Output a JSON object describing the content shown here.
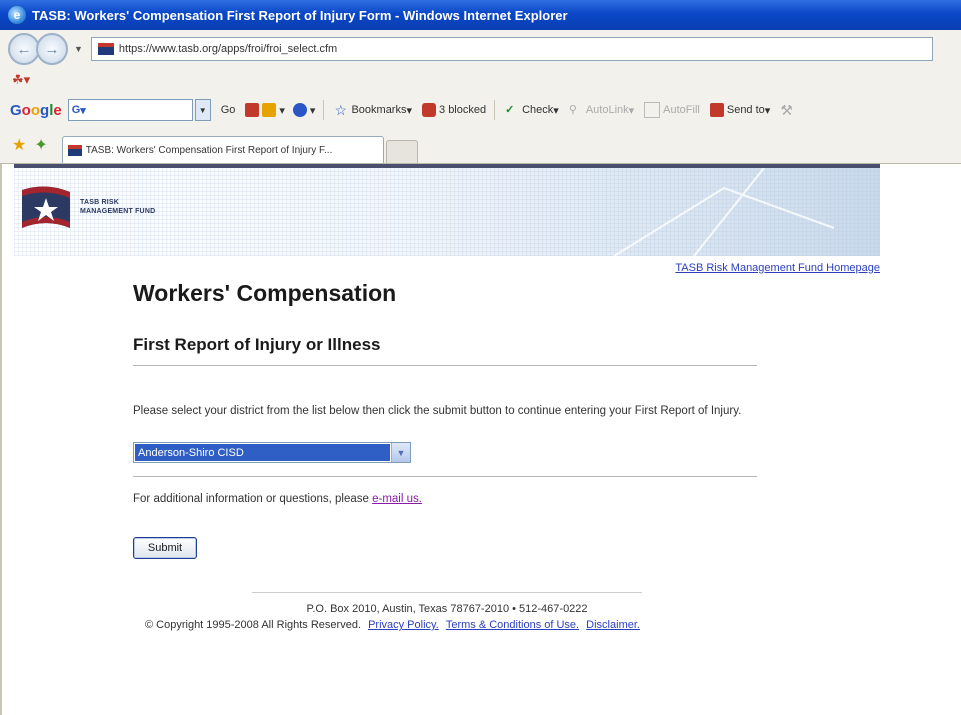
{
  "window": {
    "title": "TASB: Workers' Compensation First Report of Injury Form - Windows Internet Explorer"
  },
  "addressbar": {
    "url": "https://www.tasb.org/apps/froi/froi_select.cfm"
  },
  "google_toolbar": {
    "logo": "Google",
    "search_prefix": "G",
    "go_label": "Go",
    "bookmarks_label": "Bookmarks",
    "blocked_label": "3 blocked",
    "check_label": "Check",
    "autolink_label": "AutoLink",
    "autofill_label": "AutoFill",
    "sendto_label": "Send to"
  },
  "tabs": [
    {
      "label": "TASB: Workers' Compensation First Report of Injury F..."
    }
  ],
  "banner": {
    "logo_line1": "TASB RISK",
    "logo_line2": "MANAGEMENT FUND"
  },
  "page": {
    "home_link": "TASB Risk Management Fund Homepage",
    "title": "Workers' Compensation",
    "subtitle": "First Report of Injury or Illness",
    "instructions": "Please select your district from the list below then click the submit button to continue entering your First Report of Injury.",
    "district_selected": "Anderson-Shiro CISD",
    "additional_info": "For additional information or questions, please",
    "email_link": "e-mail us.",
    "submit_label": "Submit"
  },
  "footer": {
    "address": "P.O. Box 2010, Austin, Texas 78767-2010 • 512-467-0222",
    "copyright": "© Copyright 1995-2008 All Rights Reserved.",
    "privacy": "Privacy Policy.",
    "terms": "Terms & Conditions of Use.",
    "disclaimer": "Disclaimer."
  },
  "colors": {
    "titlebar": "#0a47c8",
    "select_highlight": "#2f5fc4",
    "link": "#2b3fbf",
    "visited_link": "#8a1aa8"
  }
}
